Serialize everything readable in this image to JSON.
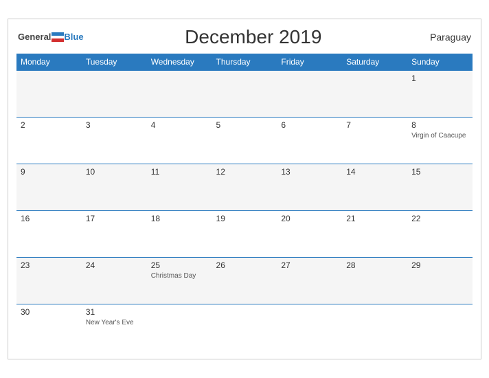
{
  "header": {
    "title": "December 2019",
    "country": "Paraguay",
    "logo": {
      "general": "General",
      "blue": "Blue"
    }
  },
  "weekdays": [
    "Monday",
    "Tuesday",
    "Wednesday",
    "Thursday",
    "Friday",
    "Saturday",
    "Sunday"
  ],
  "weeks": [
    [
      {
        "day": "",
        "holiday": ""
      },
      {
        "day": "",
        "holiday": ""
      },
      {
        "day": "",
        "holiday": ""
      },
      {
        "day": "",
        "holiday": ""
      },
      {
        "day": "",
        "holiday": ""
      },
      {
        "day": "",
        "holiday": ""
      },
      {
        "day": "1",
        "holiday": ""
      }
    ],
    [
      {
        "day": "2",
        "holiday": ""
      },
      {
        "day": "3",
        "holiday": ""
      },
      {
        "day": "4",
        "holiday": ""
      },
      {
        "day": "5",
        "holiday": ""
      },
      {
        "day": "6",
        "holiday": ""
      },
      {
        "day": "7",
        "holiday": ""
      },
      {
        "day": "8",
        "holiday": "Virgin of Caacupe"
      }
    ],
    [
      {
        "day": "9",
        "holiday": ""
      },
      {
        "day": "10",
        "holiday": ""
      },
      {
        "day": "11",
        "holiday": ""
      },
      {
        "day": "12",
        "holiday": ""
      },
      {
        "day": "13",
        "holiday": ""
      },
      {
        "day": "14",
        "holiday": ""
      },
      {
        "day": "15",
        "holiday": ""
      }
    ],
    [
      {
        "day": "16",
        "holiday": ""
      },
      {
        "day": "17",
        "holiday": ""
      },
      {
        "day": "18",
        "holiday": ""
      },
      {
        "day": "19",
        "holiday": ""
      },
      {
        "day": "20",
        "holiday": ""
      },
      {
        "day": "21",
        "holiday": ""
      },
      {
        "day": "22",
        "holiday": ""
      }
    ],
    [
      {
        "day": "23",
        "holiday": ""
      },
      {
        "day": "24",
        "holiday": ""
      },
      {
        "day": "25",
        "holiday": "Christmas Day"
      },
      {
        "day": "26",
        "holiday": ""
      },
      {
        "day": "27",
        "holiday": ""
      },
      {
        "day": "28",
        "holiday": ""
      },
      {
        "day": "29",
        "holiday": ""
      }
    ],
    [
      {
        "day": "30",
        "holiday": ""
      },
      {
        "day": "31",
        "holiday": "New Year's Eve"
      },
      {
        "day": "",
        "holiday": ""
      },
      {
        "day": "",
        "holiday": ""
      },
      {
        "day": "",
        "holiday": ""
      },
      {
        "day": "",
        "holiday": ""
      },
      {
        "day": "",
        "holiday": ""
      }
    ]
  ]
}
